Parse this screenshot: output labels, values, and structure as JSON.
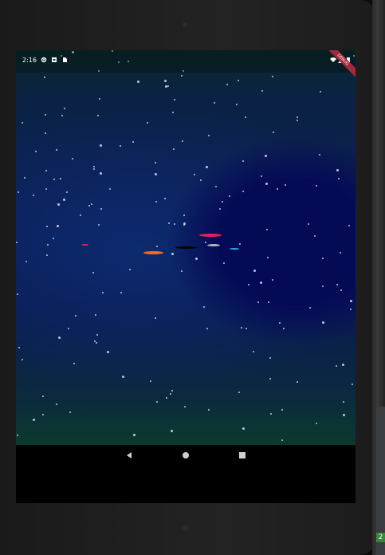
{
  "status_bar": {
    "time": "2:16",
    "icons": [
      "settings-icon",
      "sim-icon",
      "battery-saver-icon"
    ],
    "right_icons": [
      "wifi-icon",
      "signal-icon",
      "battery-icon"
    ],
    "debug_banner": "DEBUG"
  },
  "game": {
    "background": "starfield",
    "ships": [
      {
        "name": "red-ship",
        "color": "#e0225a"
      },
      {
        "name": "orange-ship",
        "color": "#f26b2a"
      },
      {
        "name": "black-ship",
        "color": "#000000"
      },
      {
        "name": "grey-ship",
        "color": "#b7b7b7"
      },
      {
        "name": "blue-ship",
        "color": "#2aa6f2"
      },
      {
        "name": "small-red-ship",
        "color": "#e0225a"
      }
    ]
  },
  "nav_bar": {
    "buttons": [
      "back-icon",
      "home-icon",
      "recents-icon"
    ]
  },
  "edge_badge": "2"
}
